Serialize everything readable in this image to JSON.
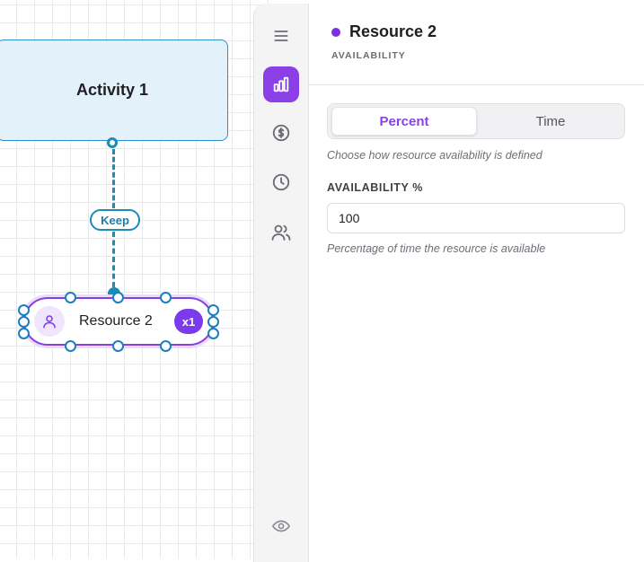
{
  "canvas": {
    "activity_node": {
      "label": "Activity 1"
    },
    "link": {
      "label": "Keep"
    },
    "resource_node": {
      "label": "Resource 2",
      "count_badge": "x1",
      "avatar_icon": "user-icon"
    }
  },
  "rail": {
    "items": [
      {
        "icon": "menu-icon",
        "active": false
      },
      {
        "icon": "chart-icon",
        "active": true
      },
      {
        "icon": "dollar-icon",
        "active": false
      },
      {
        "icon": "clock-icon",
        "active": false
      },
      {
        "icon": "users-icon",
        "active": false
      },
      {
        "icon": "eye-icon",
        "active": false
      }
    ]
  },
  "panel": {
    "title": "Resource 2",
    "subtitle": "AVAILABILITY",
    "mode_toggle": {
      "options": [
        "Percent",
        "Time"
      ],
      "selected": "Percent"
    },
    "mode_hint": "Choose how resource availability is defined",
    "availability": {
      "label": "AVAILABILITY %",
      "value": "100",
      "hint": "Percentage of time the resource is available"
    }
  },
  "colors": {
    "accent_purple": "#8b3fe6",
    "link_blue": "#1b8db5",
    "activity_fill": "#e3f1fb"
  }
}
